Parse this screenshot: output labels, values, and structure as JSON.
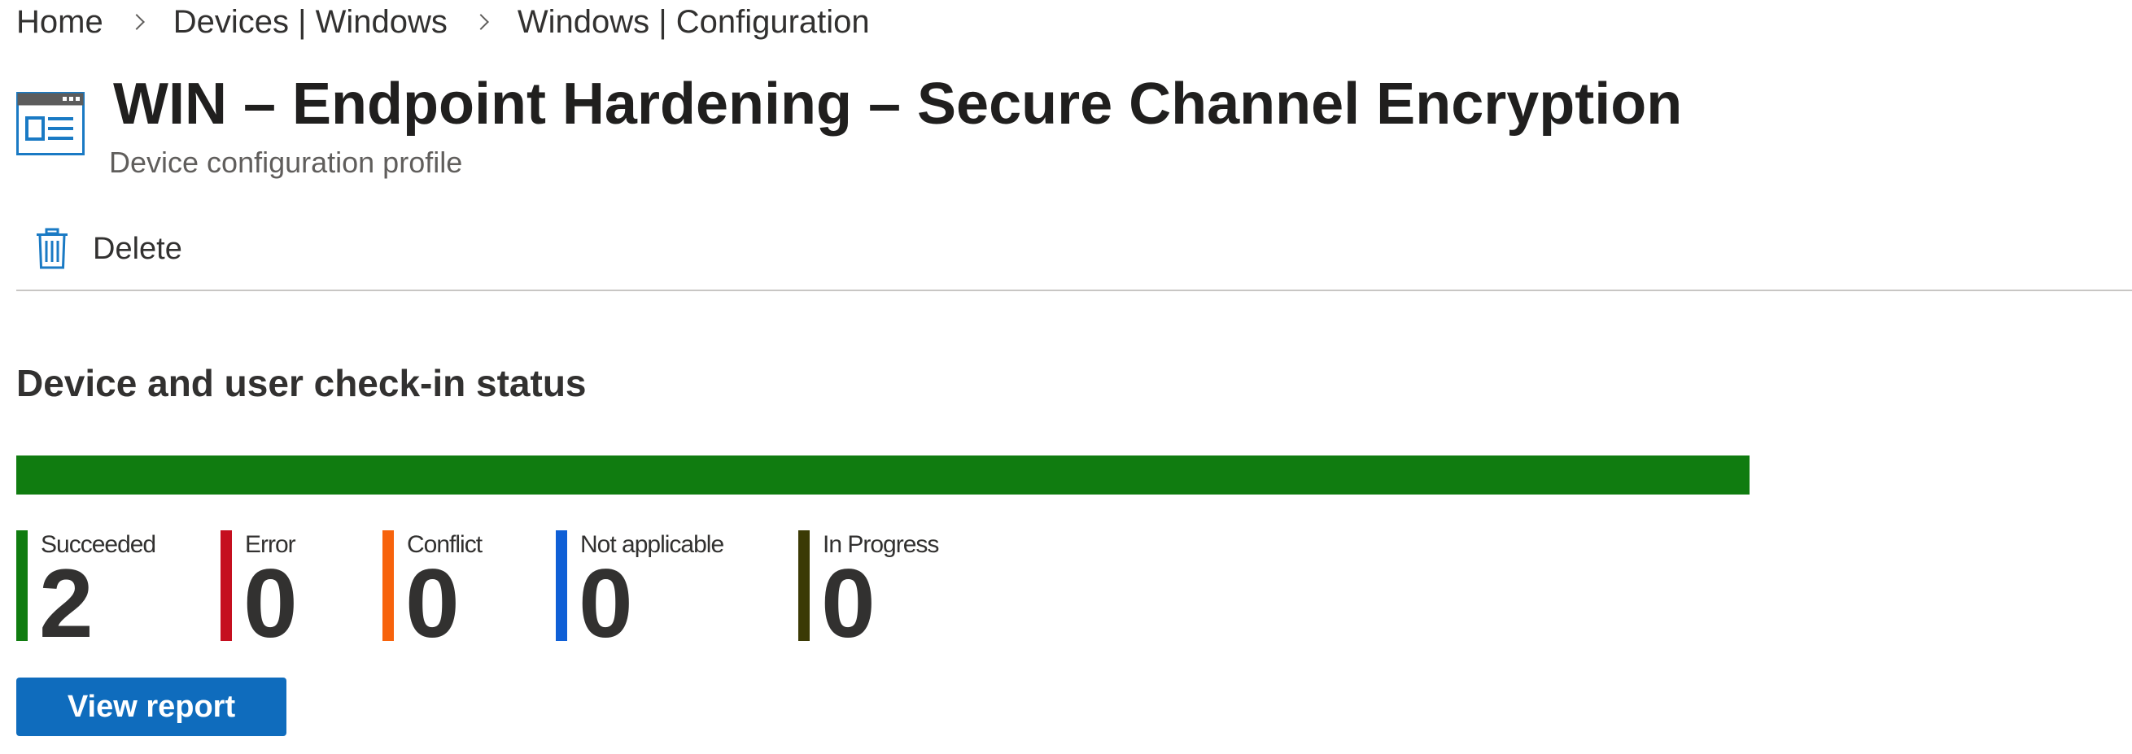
{
  "breadcrumb": {
    "items": [
      "Home",
      "Devices | Windows",
      "Windows | Configuration"
    ]
  },
  "header": {
    "icon": "configuration-profile-icon",
    "title": "WIN – Endpoint Hardening – Secure Channel Encryption",
    "subtitle": "Device configuration profile"
  },
  "toolbar": {
    "delete_label": "Delete",
    "delete_icon": "trash-icon"
  },
  "checkin_status": {
    "title": "Device and user check-in status",
    "statuses": [
      {
        "label": "Succeeded",
        "value": 2,
        "color": "#107c10"
      },
      {
        "label": "Error",
        "value": 0,
        "color": "#c50f1f"
      },
      {
        "label": "Conflict",
        "value": 0,
        "color": "#f7630c"
      },
      {
        "label": "Not applicable",
        "value": 0,
        "color": "#0f5fd6"
      },
      {
        "label": "In Progress",
        "value": 0,
        "color": "#3b3a05"
      }
    ],
    "view_report_label": "View report"
  },
  "colors": {
    "accent": "#0f6cbd",
    "icon_blue": "#1a7ac4"
  }
}
